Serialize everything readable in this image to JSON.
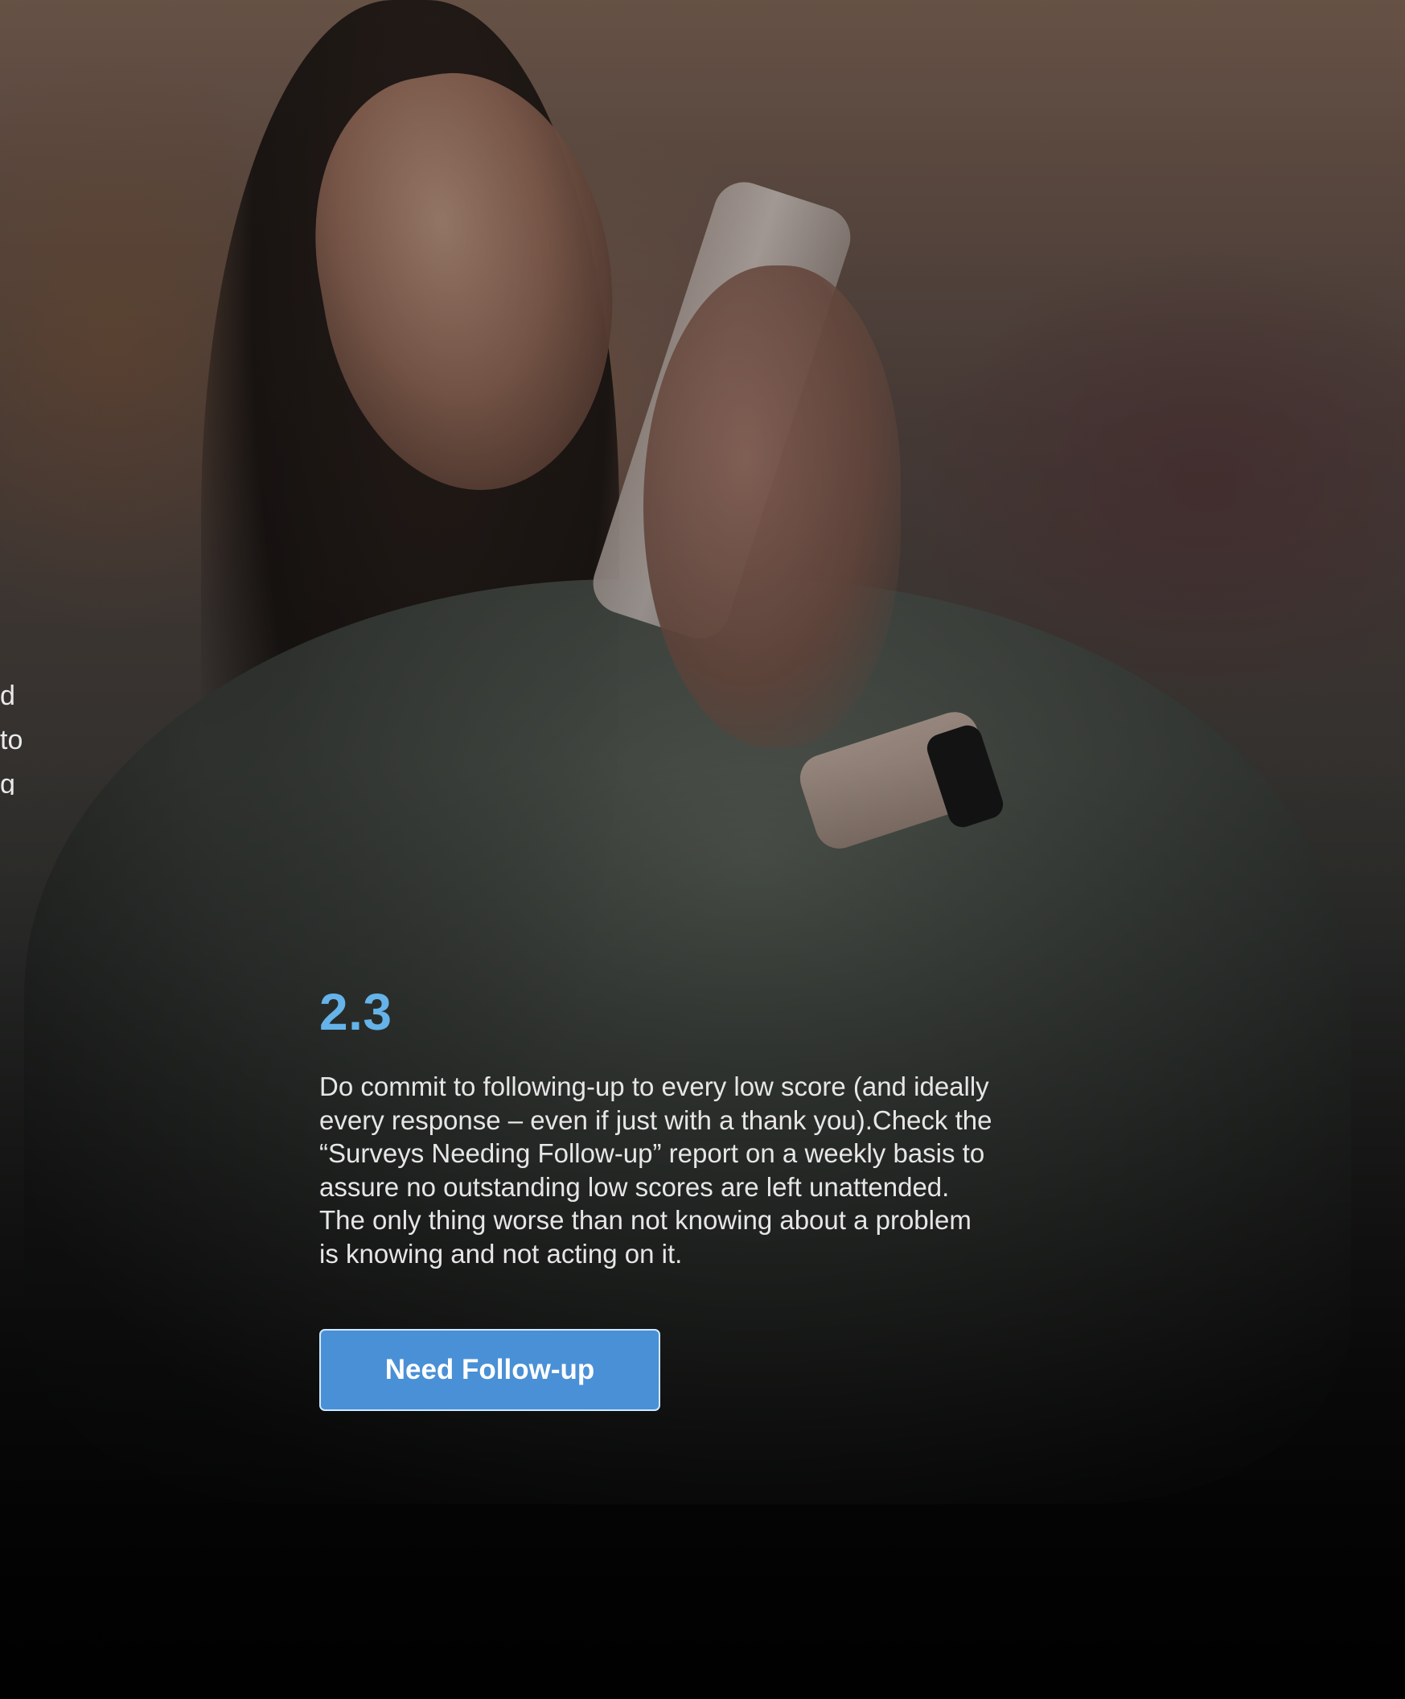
{
  "hero": {
    "background_photo": "woman-on-phone-photo"
  },
  "left_partial_text": {
    "lines": [
      "d",
      "to",
      "g"
    ]
  },
  "content": {
    "section_number": "2.3",
    "body_lines": [
      "Do commit to following-up to every low score (and ideally",
      "every response – even if just with a thank you).Check the",
      "“Surveys Needing Follow-up” report on a weekly basis to",
      "assure no outstanding low scores are left unattended.",
      "The only thing worse than not knowing about a problem",
      "is knowing and not acting on it."
    ]
  },
  "cta": {
    "label": "Need Follow-up"
  },
  "colors": {
    "accent": "#65b3e9",
    "button": "#4a90d6",
    "button_border": "#cfe8ff",
    "text": "#e6e6e6"
  }
}
